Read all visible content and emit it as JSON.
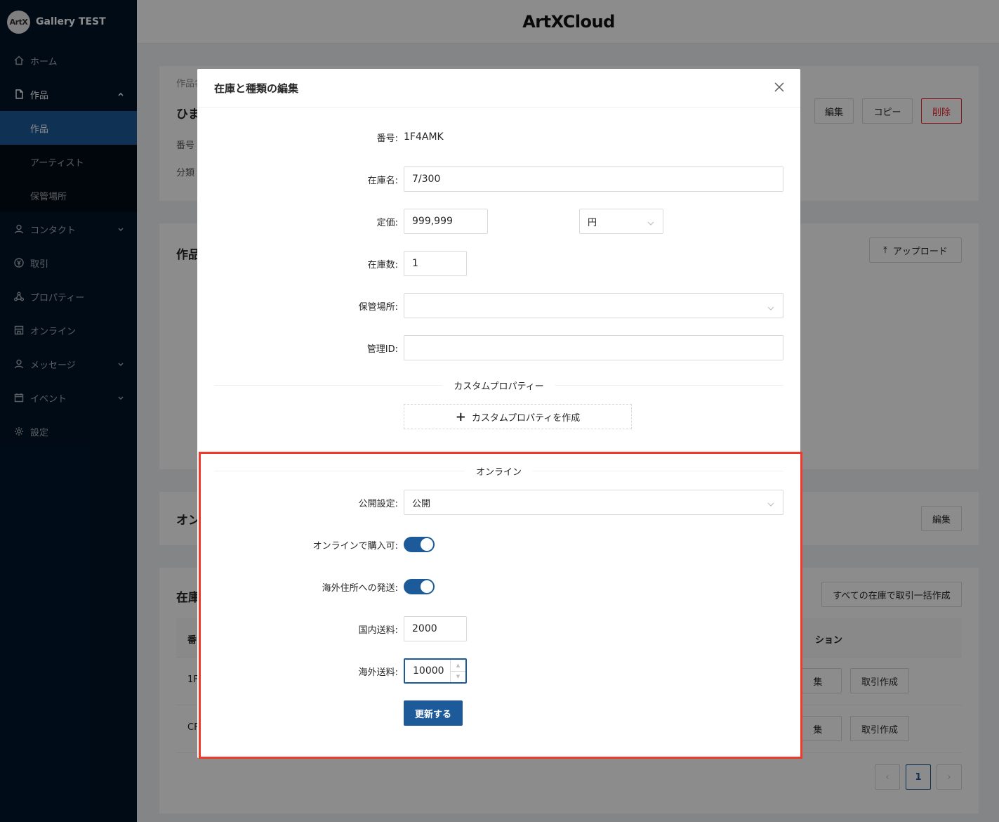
{
  "app": {
    "org_name": "Gallery TEST",
    "logo_initials": "ArtX",
    "top_logo": "ArtXCloud"
  },
  "sidebar": {
    "items": [
      {
        "label": "ホーム",
        "icon": "home-icon"
      },
      {
        "label": "作品",
        "icon": "file-icon",
        "expanded": true,
        "children": [
          {
            "label": "作品",
            "active": true
          },
          {
            "label": "アーティスト"
          },
          {
            "label": "保管場所"
          }
        ]
      },
      {
        "label": "コンタクト",
        "icon": "user-icon",
        "has_children": true
      },
      {
        "label": "取引",
        "icon": "yen-circle-icon"
      },
      {
        "label": "プロパティー",
        "icon": "nodes-icon"
      },
      {
        "label": "オンライン",
        "icon": "shop-icon"
      },
      {
        "label": "メッセージ",
        "icon": "user-icon",
        "has_children": true
      },
      {
        "label": "イベント",
        "icon": "calendar-icon",
        "has_children": true
      },
      {
        "label": "設定",
        "icon": "gear-icon"
      }
    ]
  },
  "background": {
    "card1_label": "作品名",
    "card1_title": "ひま",
    "card1_row1": "番号",
    "card1_row2": "分類",
    "btn_edit": "編集",
    "btn_copy": "コピー",
    "btn_delete": "削除",
    "card2_title": "作品",
    "btn_upload": "アップロード",
    "card3_title": "オン",
    "card3_edit": "編集",
    "card4_title": "在庫",
    "btn_bulk": "すべての在庫で取引一括作成",
    "col_no": "番",
    "col_action": "ション",
    "row1_no": "1F",
    "row2_no": "CF",
    "row_edit": "集",
    "row_create": "取引作成",
    "page_current": "1",
    "page_prev": "‹",
    "page_next": "›"
  },
  "modal": {
    "title": "在庫と種類の編集",
    "fields": {
      "number_label": "番号:",
      "number_value": "1F4AMK",
      "stock_name_label": "在庫名:",
      "stock_name_value": "7/300",
      "price_label": "定価:",
      "price_value": "999,999",
      "currency_value": "円",
      "quantity_label": "在庫数:",
      "quantity_value": "1",
      "storage_label": "保管場所:",
      "storage_value": "",
      "manage_id_label": "管理ID:",
      "manage_id_value": ""
    },
    "custom_section_title": "カスタムプロパティー",
    "custom_create_button": "カスタムプロパティを作成",
    "online_section_title": "オンライン",
    "online": {
      "visibility_label": "公開設定:",
      "visibility_value": "公開",
      "purchasable_label": "オンラインで購入可:",
      "purchasable_on": true,
      "overseas_label": "海外住所への発送:",
      "overseas_on": true,
      "domestic_fee_label": "国内送料:",
      "domestic_fee_value": "2000",
      "overseas_fee_label": "海外送料:",
      "overseas_fee_value": "10000"
    },
    "submit_button": "更新する"
  },
  "colors": {
    "primary": "#1d5a9a",
    "sidebar_bg": "#001529",
    "highlight": "#f0392b",
    "danger": "#f5222d"
  }
}
